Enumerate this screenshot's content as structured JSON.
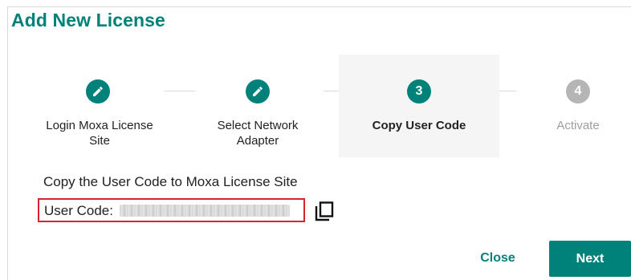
{
  "dialog": {
    "title": "Add New License"
  },
  "stepper": {
    "steps": [
      {
        "number": "1",
        "label": "Login Moxa License Site",
        "state": "completed",
        "icon": "pencil-icon"
      },
      {
        "number": "2",
        "label": "Select Network Adapter",
        "state": "completed",
        "icon": "pencil-icon"
      },
      {
        "number": "3",
        "label": "Copy User Code",
        "state": "active"
      },
      {
        "number": "4",
        "label": "Activate",
        "state": "pending"
      }
    ]
  },
  "content": {
    "instruction": "Copy the User Code to Moxa License Site",
    "user_code_label": "User Code:",
    "copy_icon": "copy-icon"
  },
  "actions": {
    "close_label": "Close",
    "next_label": "Next"
  },
  "colors": {
    "accent": "#00827a",
    "pending": "#b5b5b5",
    "highlight_border": "#d7262b",
    "active_step_bg": "#f5f5f5"
  }
}
